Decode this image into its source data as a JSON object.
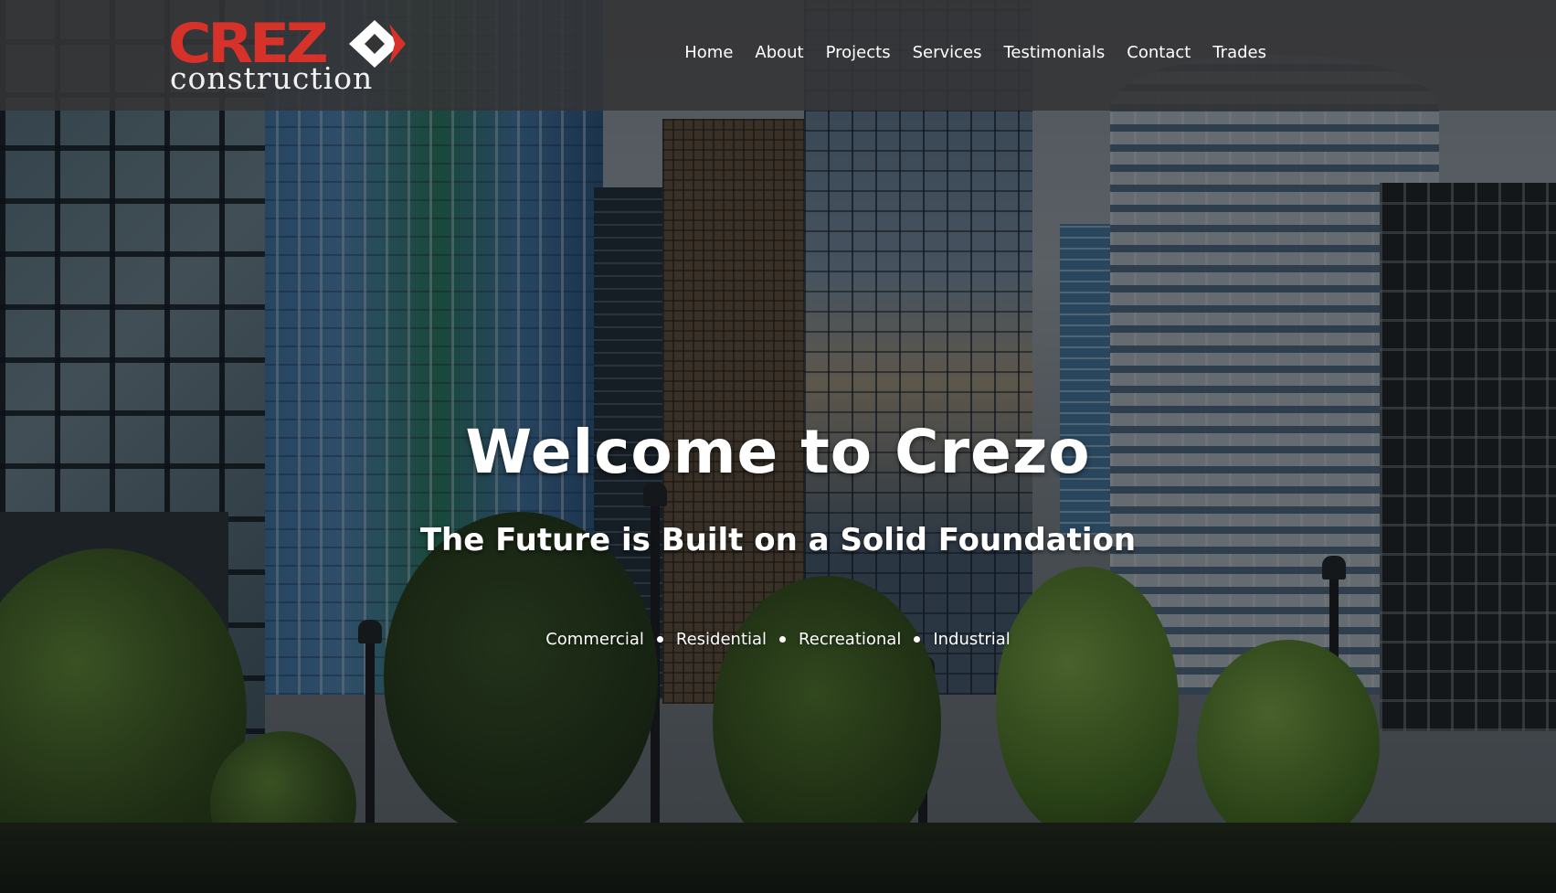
{
  "brand": {
    "name_primary": "CREZ",
    "name_secondary": "construction",
    "primary_color": "#d6322a",
    "secondary_color": "#f1f1f1",
    "mark_icon": "diamond-o-icon"
  },
  "nav": {
    "items": [
      {
        "label": "Home"
      },
      {
        "label": "About"
      },
      {
        "label": "Projects"
      },
      {
        "label": "Services"
      },
      {
        "label": "Testimonials"
      },
      {
        "label": "Contact"
      },
      {
        "label": "Trades"
      }
    ]
  },
  "hero": {
    "title": "Welcome to Crezo",
    "subtitle": "The Future is Built on a Solid Foundation",
    "sectors": [
      "Commercial",
      "Residential",
      "Recreational",
      "Industrial"
    ]
  }
}
